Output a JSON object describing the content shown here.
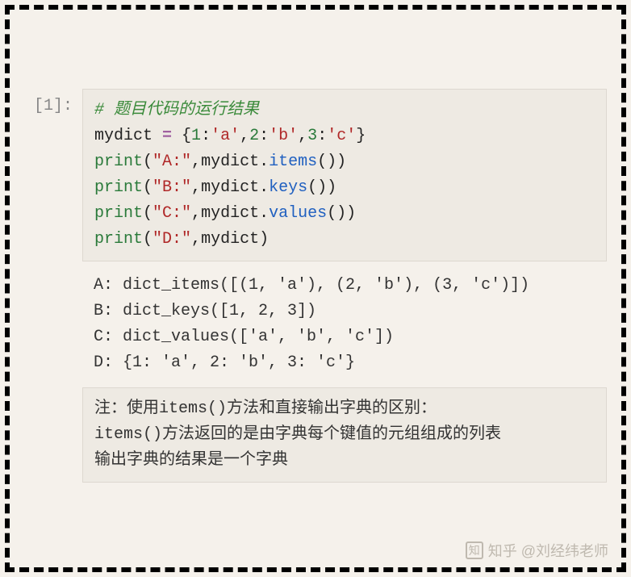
{
  "prompt": "[1]:",
  "code": {
    "comment": "# 题目代码的运行结果",
    "l2_var": "mydict",
    "l2_eq": " = ",
    "l2_brace_open": "{",
    "l2_k1": "1",
    "l2_c": ":",
    "l2_v1": "'a'",
    "l2_cm": ",",
    "l2_k2": "2",
    "l2_v2": "'b'",
    "l2_k3": "3",
    "l2_v3": "'c'",
    "l2_brace_close": "}",
    "print": "print",
    "l3_s": "\"A:\"",
    "l3_m": "items",
    "l4_s": "\"B:\"",
    "l4_m": "keys",
    "l5_s": "\"C:\"",
    "l5_m": "values",
    "l6_s": "\"D:\"",
    "paren_o": "(",
    "paren_c": ")",
    "comma": ",",
    "dot": "."
  },
  "output": {
    "l1": "A: dict_items([(1, 'a'), (2, 'b'), (3, 'c')])",
    "l2": "B: dict_keys([1, 2, 3])",
    "l3": "C: dict_values(['a', 'b', 'c'])",
    "l4": "D: {1: 'a', 2: 'b', 3: 'c'}"
  },
  "note": {
    "l1": "注：使用items()方法和直接输出字典的区别：",
    "l2": "items()方法返回的是由字典每个键值的元组组成的列表",
    "l3": "输出字典的结果是一个字典"
  },
  "watermark": {
    "logo": "知",
    "text": "知乎 @刘经纬老师"
  }
}
